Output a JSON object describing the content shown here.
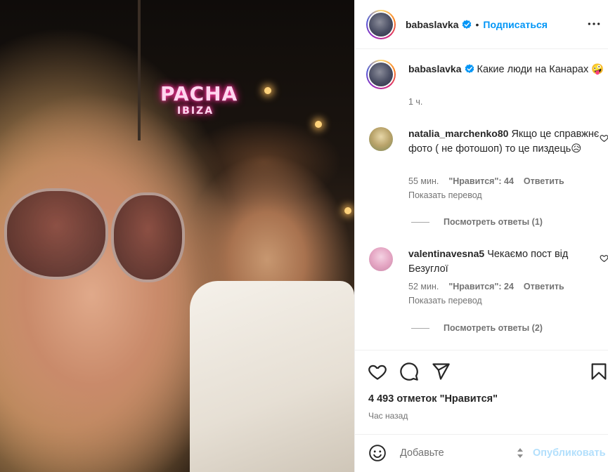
{
  "post": {
    "author": "babaslavka",
    "follow_label": "Подписаться",
    "dot": "•",
    "photo_sign": {
      "line1": "PACHA",
      "line2": "IBIZA"
    }
  },
  "caption": {
    "author": "babaslavka",
    "text": "Какие люди на Канарах 🤪",
    "time": "1 ч."
  },
  "comments": [
    {
      "author": "natalia_marchenko80",
      "text": "Якщо це справжнє фото ( не фотошоп) то це пиздець😥",
      "time": "55 мин.",
      "likes": "\"Нравится\": 44",
      "reply_label": "Ответить",
      "translate_label": "Показать перевод",
      "view_replies": "Посмотреть ответы (1)"
    },
    {
      "author": "valentinavesna5",
      "text": "Чекаємо пост від Безуглої",
      "time": "52 мин.",
      "likes": "\"Нравится\": 24",
      "reply_label": "Ответить",
      "translate_label": "Показать перевод",
      "view_replies": "Посмотреть ответы (2)"
    }
  ],
  "actions": {
    "icons": [
      "heart-icon",
      "comment-icon",
      "share-icon",
      "bookmark-icon"
    ],
    "likes_count": "4 493 отметок \"Нравится\"",
    "time_ago": "Час назад"
  },
  "add_comment": {
    "placeholder": "Добавьте",
    "publish_label": "Опубликовать"
  },
  "colors": {
    "accent": "#0095f6",
    "publish_disabled": "#b2dffc",
    "muted_text": "#737373"
  }
}
